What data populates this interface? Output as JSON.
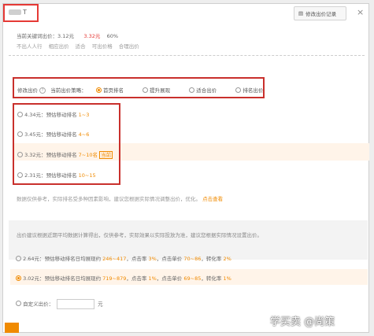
{
  "dialog": {
    "title": "T",
    "history_button": "修改出价记录",
    "close": "×"
  },
  "info": {
    "current_bid_label": "当前关键词出价：",
    "current_bid": "3.12元",
    "quality_bid": "3.32元",
    "quality_score": "60%",
    "sub_text": "不出人人行  相应出价  适合  可出价格  合理出价"
  },
  "strategy": {
    "label": "修改出价",
    "subject_label": "当前出价策略：",
    "options": [
      "首页排名",
      "提升展现",
      "适合出价",
      "排名出价"
    ]
  },
  "ranks": [
    {
      "price": "4.34元：",
      "text": "预估移动排名",
      "value": "1~3"
    },
    {
      "price": "3.45元：",
      "text": "预估移动排名",
      "value": "4~6"
    },
    {
      "price": "3.32元：",
      "text": "预估移动排名",
      "value": "7~10名",
      "badge": "当前"
    },
    {
      "price": "2.31元：",
      "text": "预估移动排名",
      "value": "10~15"
    }
  ],
  "hint": {
    "text": "数据仅供参考，实际排名受多种因素影响，建议您根据实际情况调整出价，优化。",
    "link": "点击查看"
  },
  "band": {
    "text": "出价建议根据近期平均数据计算得出，仅供参考，实际效果以实际投放为准，建议您根据实际情况设置出价。"
  },
  "suggestions": [
    {
      "price": "2.64元：",
      "text": "预估移动排名日均展现约",
      "range1": "246~417",
      "click_label": "，点击率",
      "rate1": "3%",
      "cost_label": "，点击单价",
      "range2": "70~86",
      "conv_label": "，转化率",
      "rate2": "2%"
    },
    {
      "price": "3.02元：",
      "text": "预估移动排名日均展现约",
      "range1": "719~879",
      "click_label": "，点击率",
      "rate1": "1%",
      "cost_label": "，点击单价",
      "range2": "69~85",
      "conv_label": "，转化率",
      "rate2": "1%"
    }
  ],
  "custom": {
    "label": "自定义出价：",
    "unit": "元"
  },
  "watermark": "学买卖 @尚策"
}
